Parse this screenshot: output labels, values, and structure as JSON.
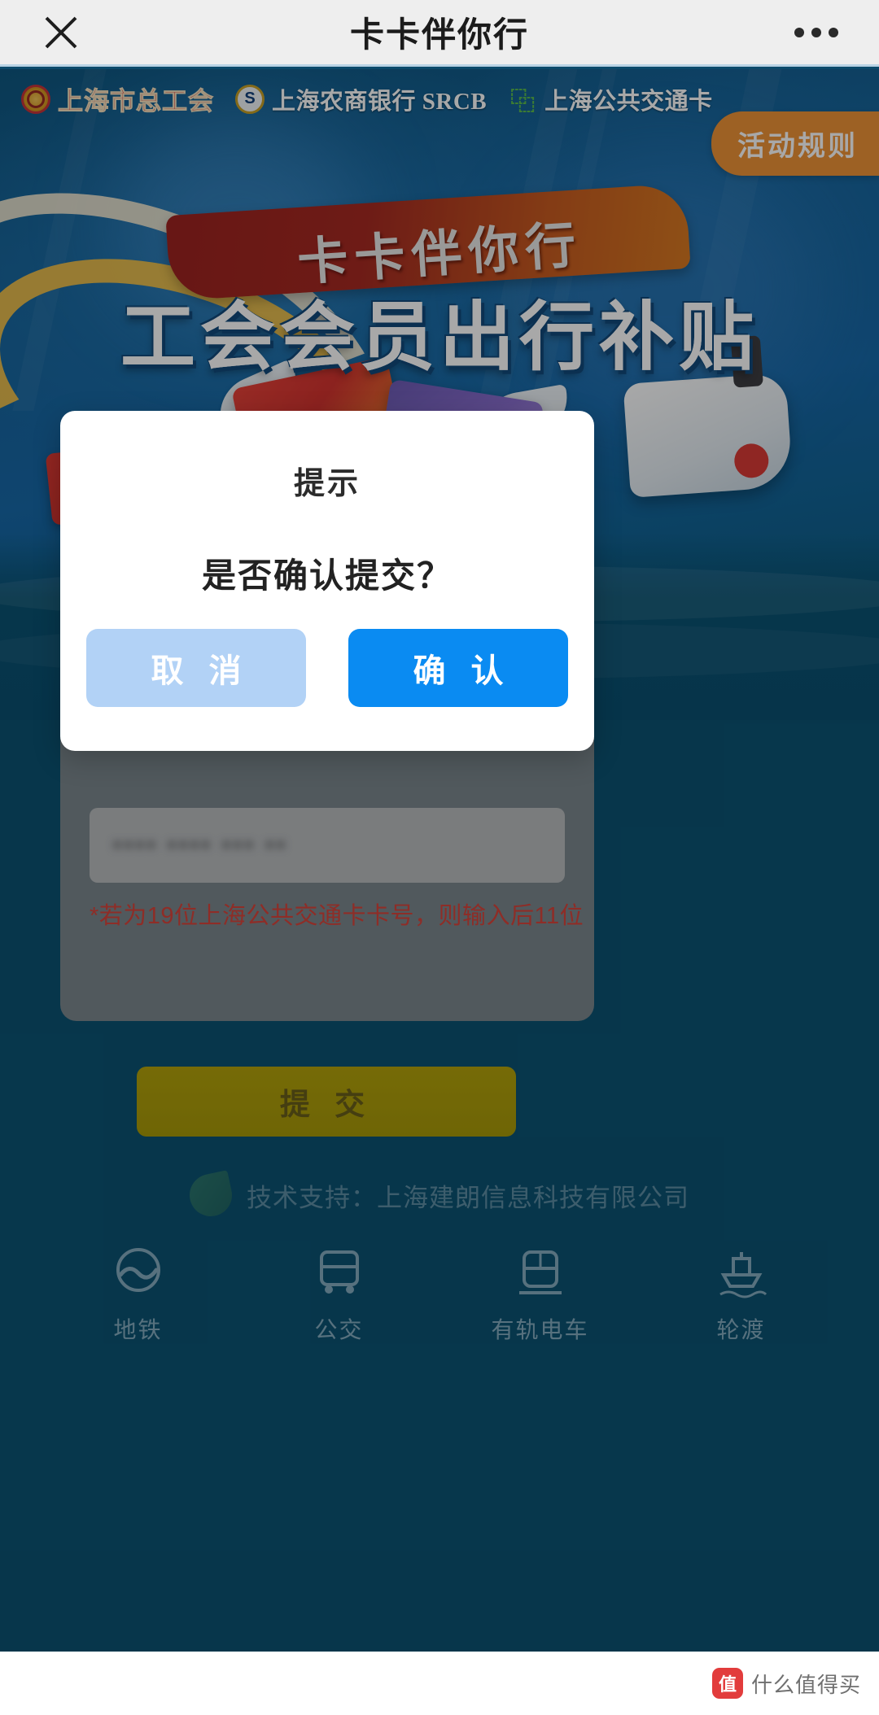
{
  "topbar": {
    "title": "卡卡伴你行",
    "close_icon": "close-icon",
    "more_icon": "more-dots-icon"
  },
  "hero": {
    "logos": [
      {
        "icon": "shanghai-federation-of-trade-unions-logo",
        "text": "上海市总工会",
        "style": "red"
      },
      {
        "icon": "srcb-bank-logo",
        "text": "上海农商银行 SRCB",
        "style": "white"
      },
      {
        "icon": "shanghai-public-transport-card-logo",
        "text": "上海公共交通卡",
        "style": "white"
      }
    ],
    "rules_button": "活动规则",
    "ribbon_title": "卡卡伴你行",
    "subtitle_part1": "工",
    "subtitle_part2": "会会员出行补贴",
    "subtitle_full": "工会会员出行补贴"
  },
  "form": {
    "card_number_value": "•••• •••• ••• ••",
    "hint": "*若为19位上海公共交通卡卡号，则输入后11位",
    "submit_label": "提 交"
  },
  "footer": {
    "credit": "技术支持：上海建朗信息科技有限公司"
  },
  "bottom_nav": [
    {
      "icon": "metro-icon",
      "label": "地铁"
    },
    {
      "icon": "bus-icon",
      "label": "公交"
    },
    {
      "icon": "tram-icon",
      "label": "有轨电车"
    },
    {
      "icon": "ferry-icon",
      "label": "轮渡"
    }
  ],
  "dialog": {
    "title": "提示",
    "message": "是否确认提交？",
    "cancel_label": "取 消",
    "confirm_label": "确 认"
  },
  "watermark": {
    "badge": "值",
    "text": "什么值得买"
  },
  "colors": {
    "banner_blue": "#10618e",
    "rules_orange": "#ef9338",
    "confirm_blue": "#0a8bf2",
    "cancel_blue": "#b2d2f6",
    "submit_olive": "#b3a30b",
    "hint_red": "#d8453c"
  }
}
